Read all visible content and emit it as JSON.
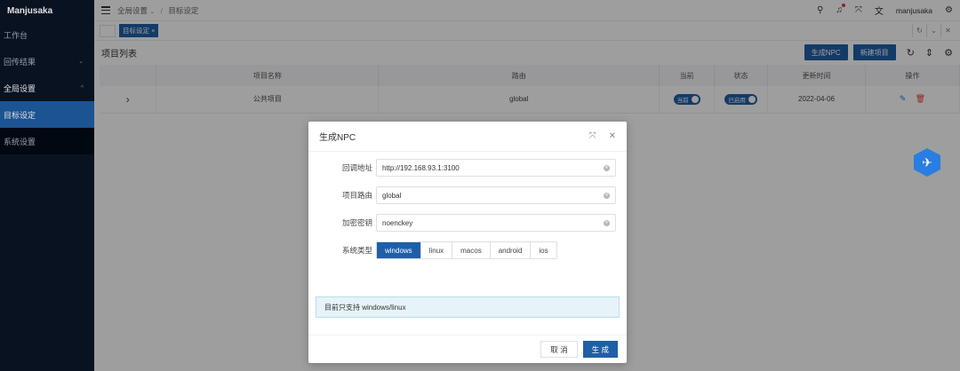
{
  "sidebar": {
    "brand": "Manjusaka",
    "items": [
      {
        "label": "工作台",
        "chevron": ""
      },
      {
        "label": "回传结果",
        "chevron": "⌄"
      },
      {
        "label": "全局设置",
        "chevron": "^"
      },
      {
        "label": "目标设定",
        "chevron": ""
      },
      {
        "label": "系统设置",
        "chevron": ""
      }
    ]
  },
  "header": {
    "breadcrumb": [
      "全局设置",
      "目标设定"
    ],
    "breadcrumb_sep": "/",
    "group_chevron": "⌄",
    "username": "manjusaka"
  },
  "tabs": [
    {
      "label": "目标设定 ×"
    }
  ],
  "list": {
    "title": "项目列表",
    "generate_npc_label": "生成NPC",
    "new_project_label": "新建项目"
  },
  "table": {
    "headers": [
      "",
      "项目名称",
      "路由",
      "当前",
      "状态",
      "更新时间",
      "操作"
    ],
    "rows": [
      {
        "expand": "›",
        "name": "公共项目",
        "route": "global",
        "current_label": "当前",
        "status_label": "已启用",
        "updated": "2022-04-06"
      }
    ]
  },
  "modal": {
    "title": "生成NPC",
    "fields": [
      {
        "label": "回调地址",
        "value": "http://192.168.93.1:3100"
      },
      {
        "label": "项目路由",
        "value": "global"
      },
      {
        "label": "加密密钥",
        "value": "noenckey"
      }
    ],
    "os_label": "系统类型",
    "os_options": [
      "windows",
      "linux",
      "macos",
      "android",
      "ios"
    ],
    "os_selected": "windows",
    "notice": "目前只支持 windows/linux",
    "cancel_label": "取 消",
    "confirm_label": "生 成"
  },
  "colors": {
    "primary": "#1f5fa8",
    "sidebar_bg": "#0a1526",
    "danger": "#e53935"
  }
}
